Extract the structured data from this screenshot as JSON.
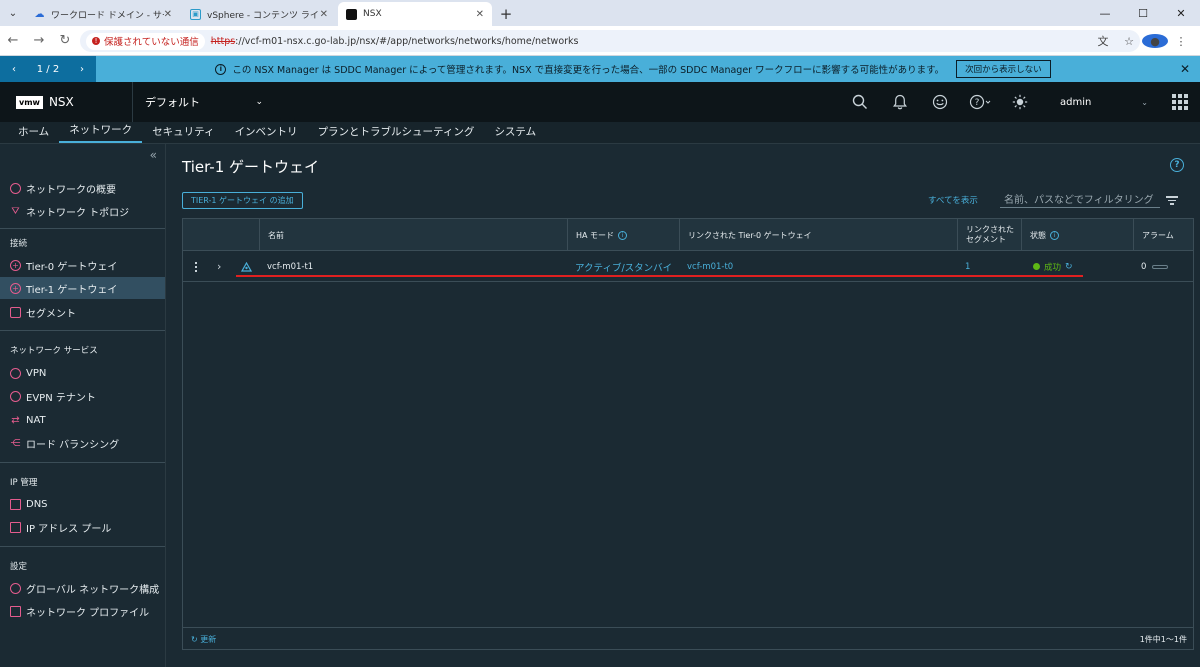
{
  "browser": {
    "tabs": [
      {
        "title": "ワークロード ドメイン - サービス",
        "active": false
      },
      {
        "title": "vSphere - コンテンツ ライブラリ",
        "active": false
      },
      {
        "title": "NSX",
        "active": true
      }
    ],
    "security_label": "保護されていない通信",
    "url_scheme": "https",
    "url_rest": "://vcf-m01-nsx.c.go-lab.jp/nsx/#/app/networks/networks/home/networks"
  },
  "banner": {
    "pager": "1 / 2",
    "message": "この NSX Manager は SDDC Manager によって管理されます。NSX で直接変更を行った場合、一部の SDDC Manager ワークフローに影響する可能性があります。",
    "dont_show": "次回から表示しない"
  },
  "header": {
    "logo": "vmw",
    "product": "NSX",
    "project": "デフォルト",
    "user": "admin"
  },
  "nav": {
    "tabs": [
      "ホーム",
      "ネットワーク",
      "セキュリティ",
      "インベントリ",
      "プランとトラブルシューティング",
      "システム"
    ],
    "active_index": 1
  },
  "sidebar": {
    "top_items": [
      "ネットワークの概要",
      "ネットワーク トポロジ"
    ],
    "section_connect": "接続",
    "connect_items": [
      "Tier-0 ゲートウェイ",
      "Tier-1 ゲートウェイ",
      "セグメント"
    ],
    "section_services": "ネットワーク サービス",
    "service_items": [
      "VPN",
      "EVPN テナント",
      "NAT",
      "ロード バランシング"
    ],
    "section_ip": "IP 管理",
    "ip_items": [
      "DNS",
      "IP アドレス プール"
    ],
    "section_settings": "設定",
    "settings_items": [
      "グローバル ネットワーク構成",
      "ネットワーク プロファイル"
    ]
  },
  "main": {
    "title": "Tier-1 ゲートウェイ",
    "add_button": "TIER-1 ゲートウェイ の追加",
    "show_all": "すべてを表示",
    "filter_placeholder": "名前、パスなどでフィルタリング",
    "columns": {
      "name": "名前",
      "ha_mode": "HA モード",
      "linked_t0": "リンクされた Tier-0 ゲートウェイ",
      "linked_segments_1": "リンクされた",
      "linked_segments_2": "セグメント",
      "status": "状態",
      "alarms": "アラーム"
    },
    "rows": [
      {
        "name": "vcf-m01-t1",
        "ha_mode": "アクティブ/スタンバイ",
        "linked_t0": "vcf-m01-t0",
        "segments": "1",
        "status": "成功",
        "alarms": "0"
      }
    ],
    "refresh": "更新",
    "count": "1件中1～1件"
  }
}
